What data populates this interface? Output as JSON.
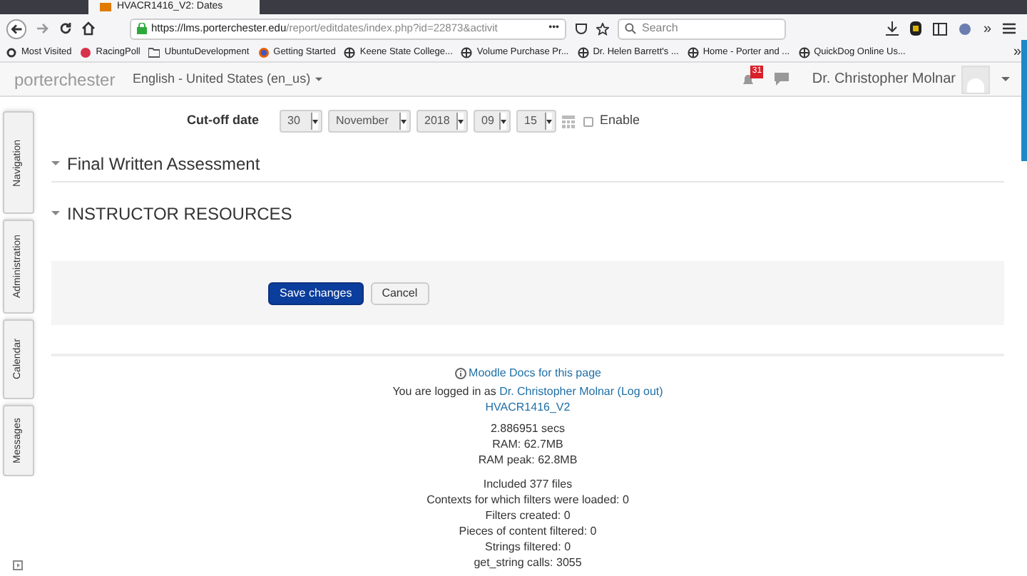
{
  "browser": {
    "tab_title": "HVACR1416_V2: Dates",
    "url_host": "https://lms.porterchester.edu",
    "url_path": "/report/editdates/index.php?id=22873&activit",
    "page_actions_glyph": "•••",
    "search_placeholder": "Search",
    "overflow_glyph": "»",
    "bookmarks": [
      {
        "label": "Most Visited",
        "kind": "gear"
      },
      {
        "label": "RacingPoll",
        "kind": "site"
      },
      {
        "label": "UbuntuDevelopment",
        "kind": "folder"
      },
      {
        "label": "Getting Started",
        "kind": "browser"
      },
      {
        "label": "Keene State College...",
        "kind": "globe"
      },
      {
        "label": "Volume Purchase Pr...",
        "kind": "globe"
      },
      {
        "label": "Dr. Helen Barrett's ...",
        "kind": "globe"
      },
      {
        "label": "Home - Porter and ...",
        "kind": "globe"
      },
      {
        "label": "QuickDog Online Us...",
        "kind": "globe"
      }
    ]
  },
  "navbar": {
    "brand": "porterchester",
    "language": "English - United States (en_us)",
    "notification_count": "31",
    "user_name": "Dr. Christopher Molnar"
  },
  "side_tabs": [
    "Navigation",
    "Administration",
    "Calendar",
    "Messages"
  ],
  "cutoff": {
    "label": "Cut-off date",
    "selects": [
      "30",
      "November",
      "2018",
      "09",
      "15"
    ],
    "enable_label": "Enable",
    "enable_checked": false
  },
  "sections": [
    {
      "title": "Final Written Assessment"
    },
    {
      "title": "INSTRUCTOR RESOURCES"
    }
  ],
  "buttons": [
    {
      "label": "Save changes",
      "kind": "primary"
    },
    {
      "label": "Cancel",
      "kind": "secondary"
    }
  ],
  "footer": {
    "docs_link": "Moodle Docs for this page",
    "logged_in_prefix": "You are logged in as",
    "user_link": "Dr. Christopher Molnar",
    "logout_link": "(Log out)",
    "course_link": "HVACR1416_V2",
    "stats_groups": [
      [
        "2.886951 secs",
        "RAM: 62.7MB",
        "RAM peak: 62.8MB"
      ],
      [
        "Included 377 files",
        "Contexts for which filters were loaded: 0",
        "Filters created: 0",
        "Pieces of content filtered: 0",
        "Strings filtered: 0",
        "get_string calls: 3055"
      ]
    ]
  }
}
